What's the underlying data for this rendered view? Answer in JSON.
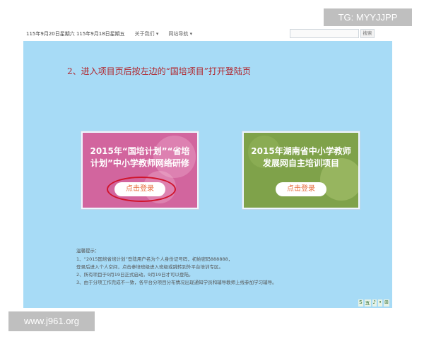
{
  "topbar": {
    "date_text": "115年9月20日星期六 115年9月18日星期五",
    "nav_about": "关于我们 ▾",
    "nav_sitemap": "网站导航 ▾",
    "search_button": "搜索"
  },
  "instruction": "2、进入项目页后按左边的“国培项目”打开登陆页",
  "cards": [
    {
      "title": "2015年“国培计划”“省培计划”中小学教师网络研修",
      "button": "点击登录",
      "highlighted": true
    },
    {
      "title": "2015年湖南省中小学教师发展网自主培训项目",
      "button": "点击登录",
      "highlighted": false
    }
  ],
  "tips": {
    "title": "温馨提示：",
    "items": [
      "1、“2015国培省培计划”登陆用户名为个人身份证号码，初始密码888888，",
      "   登录后进入个人空间，点击参培班级进入班级或跳转到外平台培训专区。",
      "2、所有项目于9月19日正式启动，9月19日才可以登陆。",
      "3、由于分项工作完成不一致，各平台分项目分布情况出现通知学员和辅导教师上线参加学习辅导。"
    ]
  },
  "bottom_icons": [
    "S",
    "五",
    "♪",
    "•",
    "⊞"
  ],
  "watermarks": {
    "top_right": "TG: MYYJJPP",
    "bottom_left": "www.j961.org"
  },
  "colors": {
    "content_bg": "#a7dbf6",
    "pink_card": "#d2659e",
    "green_card": "#7fa24a",
    "instruction_red": "#b0242b",
    "highlight_circle": "#d0142c"
  }
}
